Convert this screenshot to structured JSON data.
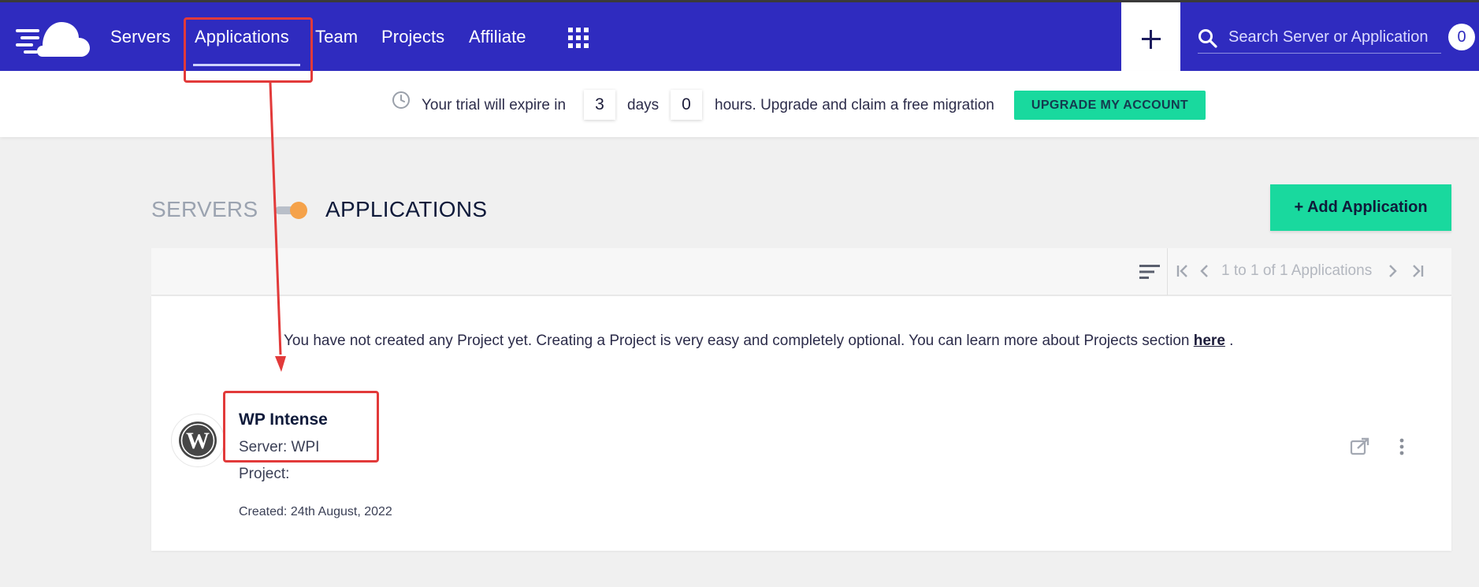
{
  "nav": {
    "logo_icon": "cloudways-logo-icon",
    "items": [
      "Servers",
      "Applications",
      "Team",
      "Projects",
      "Affiliate"
    ],
    "active": "Applications",
    "apps_grid_icon": "grid-icon",
    "add_icon": "plus-icon",
    "search": {
      "placeholder": "Search Server or Application",
      "icon": "search-icon"
    },
    "notifications_count": "0"
  },
  "trial": {
    "icon": "clock-icon",
    "prefix": "Your trial will expire in",
    "days_value": "3",
    "days_label": "days",
    "hours_value": "0",
    "suffix": "hours. Upgrade and claim a free migration",
    "upgrade_button": "UPGRADE MY ACCOUNT"
  },
  "view_toggle": {
    "servers_label": "SERVERS",
    "applications_label": "APPLICATIONS",
    "selected": "APPLICATIONS"
  },
  "add_application_button": "Add Application",
  "pagination": {
    "sort_icon": "sort-icon",
    "text": "1 to 1 of 1 Applications",
    "icons": [
      "first-page-icon",
      "prev-page-icon",
      "next-page-icon",
      "last-page-icon"
    ]
  },
  "projects_notice": {
    "text": "You have not created any Project yet. Creating a Project is very easy and completely optional. You can learn more about Projects section",
    "link": "here",
    "trail": "."
  },
  "applications": [
    {
      "name": "WP Intense",
      "server": "Server: WPI",
      "project": "Project:",
      "created": "Created: 24th August, 2022",
      "icon": "wordpress-icon",
      "actions": [
        "external-link-icon",
        "more-options-icon"
      ]
    }
  ],
  "annotations": {
    "color": "#e23a3a"
  },
  "colors": {
    "topbar": "#2f2bbf",
    "accent_green": "#19d99e",
    "toggle_knob": "#f5a24a"
  }
}
